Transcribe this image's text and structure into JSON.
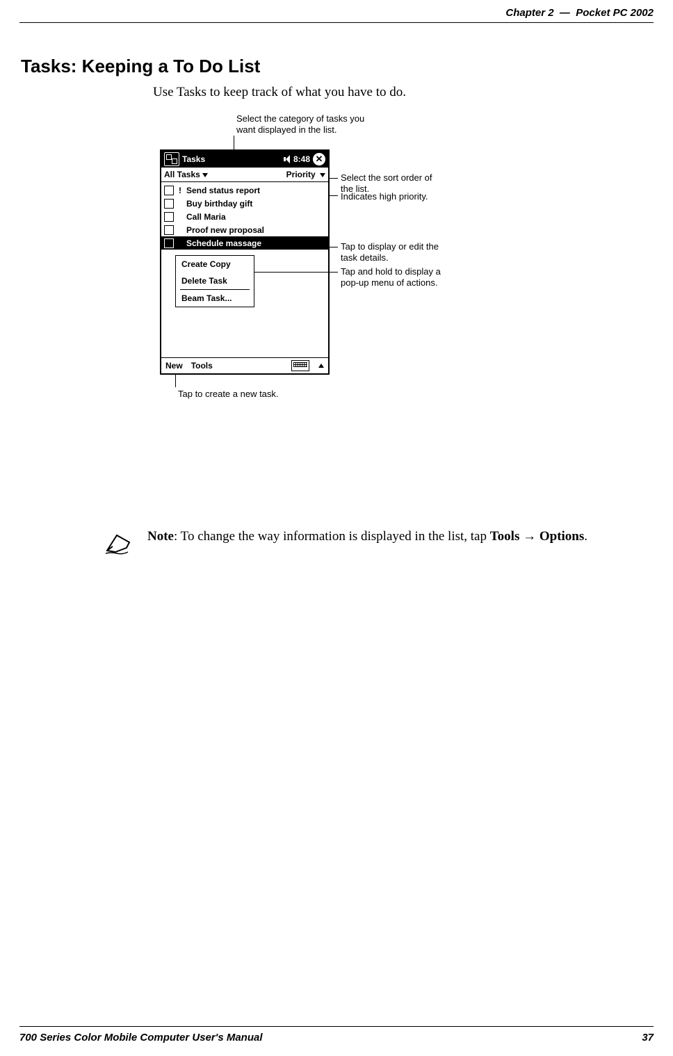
{
  "header": {
    "chapter": "Chapter  2",
    "sep": "—",
    "title": "Pocket PC 2002"
  },
  "section_heading": "Tasks: Keeping a To Do List",
  "intro": "Use Tasks to keep track of what you have to do.",
  "callouts": {
    "top": "Select the category of tasks you want displayed in the list.",
    "sort": "Select the sort order of the list.",
    "priority": "Indicates high priority.",
    "details": "Tap to display or edit the task details.",
    "popup": "Tap and hold to display a pop-up menu of actions.",
    "new": "Tap to create a new task."
  },
  "device": {
    "title": "Tasks",
    "time": "8:48",
    "filter_left": "All Tasks",
    "filter_right": "Priority",
    "tasks": {
      "t0": {
        "priority": "!",
        "label": "Send status report"
      },
      "t1": {
        "priority": "",
        "label": "Buy birthday gift"
      },
      "t2": {
        "priority": "",
        "label": "Call Maria"
      },
      "t3": {
        "priority": "",
        "label": "Proof new proposal"
      },
      "t4": {
        "priority": "",
        "label": "Schedule massage"
      }
    },
    "menu": {
      "m0": "Create Copy",
      "m1": "Delete Task",
      "m2": "Beam Task..."
    },
    "bottom": {
      "new": "New",
      "tools": "Tools"
    }
  },
  "note": {
    "label": "Note",
    "text_before": ": To change the way information is displayed in the list, tap ",
    "tools": "Tools",
    "arrow": "→",
    "options": "Options",
    "period": "."
  },
  "footer": {
    "left": "700 Series Color Mobile Computer User's Manual",
    "right": "37"
  }
}
